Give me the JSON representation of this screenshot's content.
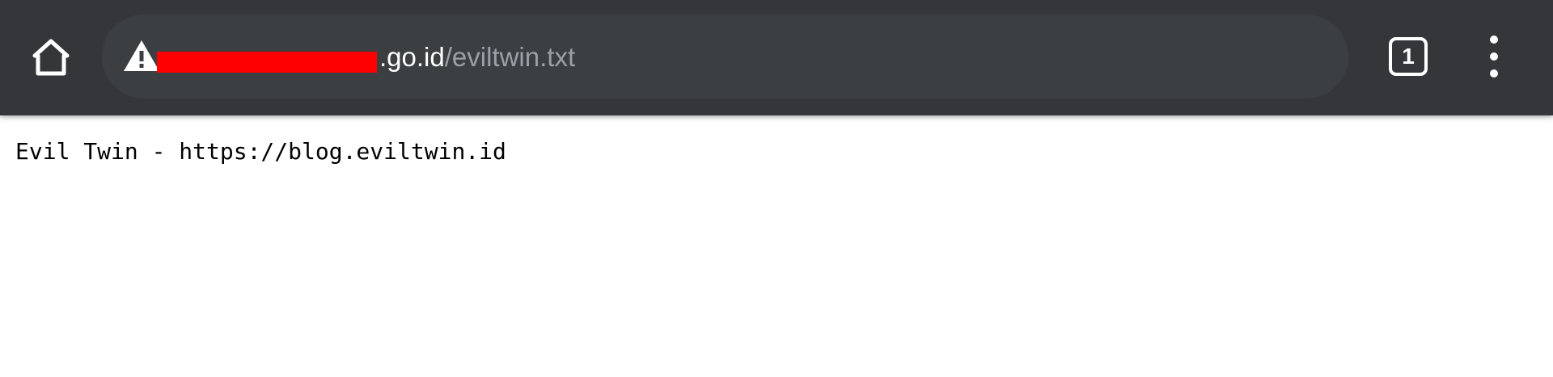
{
  "toolbar": {
    "home_icon": "home-icon",
    "security_icon": "warning-triangle-icon",
    "url_host_suffix": ".go.id",
    "url_path": "/eviltwin.txt",
    "tab_count": "1",
    "menu_icon": "vertical-ellipsis-icon",
    "redaction_color": "#ff0000"
  },
  "page": {
    "text": "Evil Twin - https://blog.eviltwin.id"
  }
}
